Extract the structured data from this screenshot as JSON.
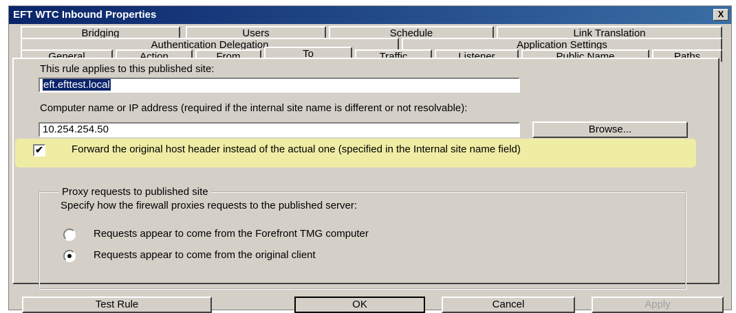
{
  "window": {
    "title": "EFT WTC Inbound Properties",
    "close_label": "X"
  },
  "tabs": {
    "row1": [
      "Bridging",
      "Users",
      "Schedule",
      "Link Translation"
    ],
    "row2": [
      "Authentication Delegation",
      "Application Settings"
    ],
    "row3": [
      "General",
      "Action",
      "From",
      "To",
      "Traffic",
      "Listener",
      "Public Name",
      "Paths"
    ],
    "active": "To"
  },
  "published_site": {
    "label": "This rule applies to this published site:",
    "value": "eft.efttest.local"
  },
  "computer": {
    "label": "Computer name or IP address (required if the internal site name is different or not resolvable):",
    "value": "10.254.254.50",
    "browse_label": "Browse..."
  },
  "forward_host_header": {
    "checked": true,
    "label": "Forward the original host header instead of the actual one (specified in the Internal site name field)"
  },
  "proxy_group": {
    "title": "Proxy requests to published site",
    "description": "Specify how the firewall proxies requests to the published server:",
    "options": [
      {
        "label": "Requests appear to come from the Forefront TMG computer",
        "selected": false
      },
      {
        "label": "Requests appear to come from the original client",
        "selected": true
      }
    ]
  },
  "buttons": {
    "test_rule": "Test Rule",
    "ok": "OK",
    "cancel": "Cancel",
    "apply": "Apply"
  },
  "colors": {
    "title_bar": "#0a246a",
    "dialog_bg": "#d4d0c8",
    "highlight": "#f2f0a0",
    "selection": "#0a246a"
  }
}
